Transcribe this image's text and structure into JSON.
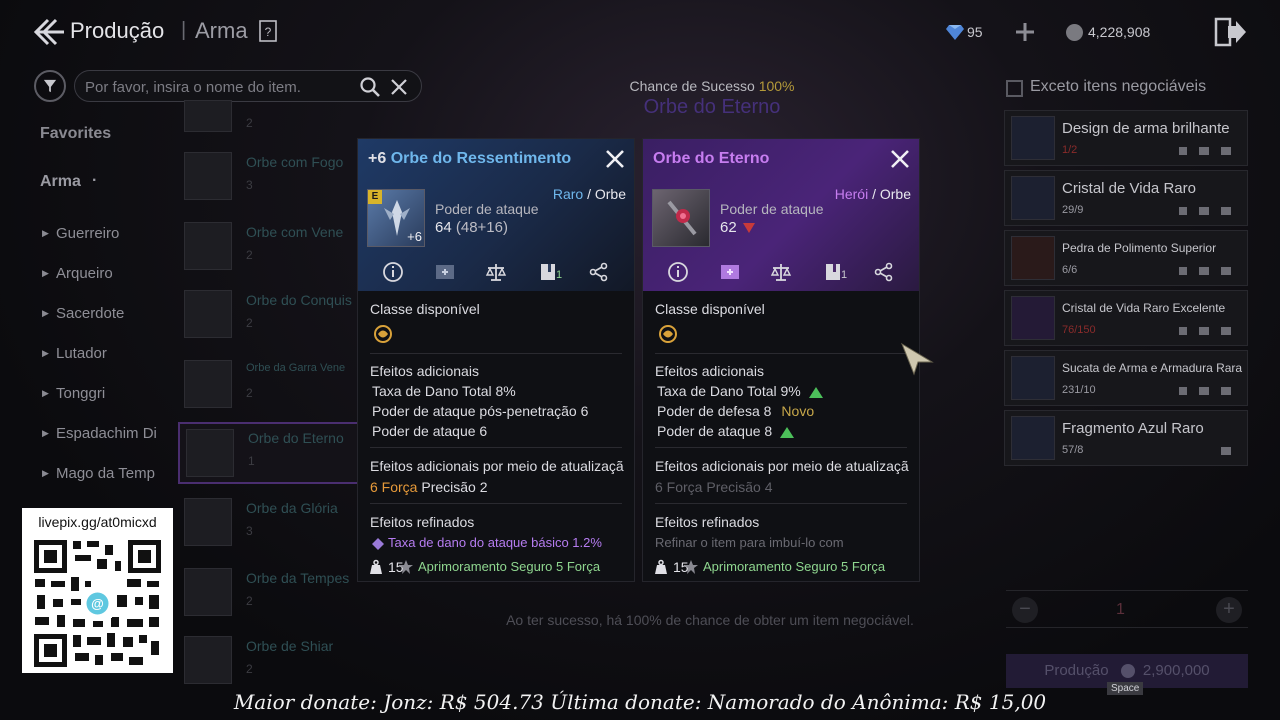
{
  "header": {
    "title": "Produção",
    "separator": "|",
    "subtitle": "Arma"
  },
  "currency": {
    "gems": "95",
    "coins": "4,228,908"
  },
  "search": {
    "placeholder": "Por favor, insira o nome do item."
  },
  "sidebar": {
    "favorites": "Favorites",
    "category": "Arma",
    "dot": "·",
    "classes": [
      "Guerreiro",
      "Arqueiro",
      "Sacerdote",
      "Lutador",
      "Tonggri",
      "Espadachim Di",
      "Mago da Temp"
    ]
  },
  "list": [
    {
      "name": "",
      "meta": "2"
    },
    {
      "name": "Orbe com Fogo",
      "meta": "3"
    },
    {
      "name": "Orbe com Vene",
      "meta": "2"
    },
    {
      "name": "Orbe do Conquis",
      "meta": "2"
    },
    {
      "name": "Orbe da Garra Vene",
      "meta": "2"
    },
    {
      "name": "Orbe do Eterno",
      "meta": "1"
    },
    {
      "name": "Orbe da Glória",
      "meta": "3"
    },
    {
      "name": "Orbe da Tempes",
      "meta": "2"
    },
    {
      "name": "Orbe de Shiar",
      "meta": "2"
    }
  ],
  "center": {
    "chance_label": "Chance de Sucesso",
    "chance_value": "100%",
    "item_name": "Orbe do Eterno",
    "note": "Ao ter sucesso, há 100% de chance de obter um item negociável."
  },
  "materials": {
    "except_label": "Exceto itens negociáveis",
    "items": [
      {
        "name": "Design de arma brilhante",
        "count": "1/2",
        "low": true
      },
      {
        "name": "Cristal de Vida Raro",
        "count": "29/9",
        "low": false
      },
      {
        "name": "Pedra de Polimento Superior",
        "count": "6/6",
        "low": false
      },
      {
        "name": "Cristal de Vida Raro Excelente",
        "count": "76/150",
        "low": true
      },
      {
        "name": "Sucata de Arma e Armadura Rara",
        "count": "231/10",
        "low": false
      },
      {
        "name": "Fragmento Azul Raro",
        "count": "57/8",
        "low": false
      }
    ],
    "quantity": "1",
    "produce_label": "Produção",
    "produce_cost": "2,900,000"
  },
  "card_left": {
    "plus": "+6",
    "name": "Orbe do Ressentimento",
    "rarity": "Raro",
    "rarity_sep": " / ",
    "type": "Orbe",
    "badge": "E",
    "enhance": "+6",
    "atk_label": "Poder de ataque",
    "atk_value": "64",
    "atk_detail": "(48+16)",
    "tool_count": "1",
    "class_title": "Classe disponível",
    "effects_title": "Efeitos adicionais",
    "effects": [
      "Taxa de Dano Total 8%",
      "Poder de ataque pós-penetração 6",
      "Poder de ataque 6"
    ],
    "upgrade_title": "Efeitos adicionais por meio de atualização",
    "upgrade_a": "6 Força",
    "upgrade_b": "Precisão 2",
    "refined_title": "Efeitos refinados",
    "refined_value": "Taxa de dano do ataque básico 1.2%",
    "foot_num": "15",
    "foot_text": "Aprimoramento Seguro 5 Força"
  },
  "card_right": {
    "name": "Orbe do Eterno",
    "rarity": "Herói",
    "rarity_sep": " / ",
    "type": "Orbe",
    "atk_label": "Poder de ataque",
    "atk_value": "62",
    "tool_count": "1",
    "class_title": "Classe disponível",
    "effects_title": "Efeitos adicionais",
    "effect_1": "Taxa de Dano Total 9%",
    "effect_2": "Poder de defesa 8",
    "effect_2_tag": "Novo",
    "effect_3": "Poder de ataque 8",
    "upgrade_title": "Efeitos adicionais por meio de atualização",
    "upgrade_value": "6 Força Precisão 4",
    "refined_title": "Efeitos refinados",
    "refined_note": "Refinar o item para imbuí-lo com",
    "foot_num": "15",
    "foot_text": "Aprimoramento Seguro 5 Força"
  },
  "overlay": {
    "qr_text": "livepix.gg/at0micxd",
    "donate": "Maior donate: Jonz: R$  504.73     Última donate: Namorado do Anônima: R$ 15,00",
    "space_key": "Space"
  },
  "colors": {
    "rare_blue": "#6fb7ec",
    "hero_purple": "#c77df0",
    "stat_up": "#4cc05a",
    "stat_down": "#c83a3a",
    "orange": "#e69a3a"
  },
  "icons": [
    "back-arrow-icon",
    "document-icon",
    "gem-icon",
    "plus-icon",
    "coin-icon",
    "exit-icon",
    "filter-icon",
    "search-icon",
    "close-icon",
    "info-icon",
    "compare-icon",
    "scale-icon",
    "book-icon",
    "share-icon",
    "class-emblem-icon",
    "cursor-icon"
  ]
}
